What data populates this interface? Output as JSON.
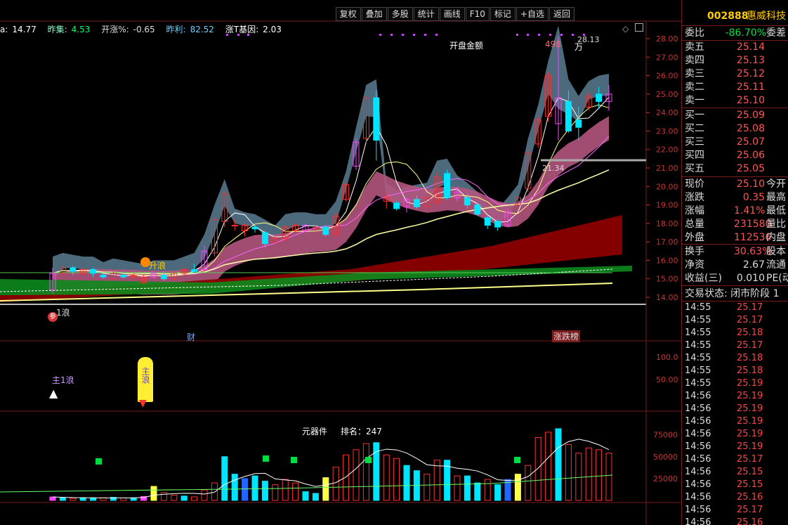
{
  "toolbar": [
    "复权",
    "叠加",
    "多股",
    "统计",
    "画线",
    "F10",
    "标记",
    "+自选",
    "返回"
  ],
  "indicator_line": {
    "a_label": "a:",
    "a_value": "14.77",
    "zj_label": "昨集:",
    "zj_value": "4.53",
    "kzf_label": "开涨%:",
    "kzf_value": "-0.65",
    "zl_label": "昨利:",
    "zl_value": "82.52",
    "ztjy_label": "涨T基因:",
    "ztjy_value": "2.03"
  },
  "main_axis": [
    "28.00",
    "27.00",
    "26.00",
    "25.00",
    "24.00",
    "23.00",
    "22.00",
    "21.00",
    "20.00",
    "19.00",
    "18.00",
    "17.00",
    "16.00",
    "15.00",
    "14.00"
  ],
  "mid_axis": [
    "100.0",
    "50.00"
  ],
  "vol_axis": [
    "75000",
    "50000",
    "25000"
  ],
  "annotations": {
    "kaipan": "开盘金额",
    "val498": "498",
    "wan": "万",
    "high": "28.13",
    "cross_time": "21.34",
    "shengliang": "升浪",
    "yilang": "1浪",
    "cai": "财",
    "zhangdiebang": "涨跌榜",
    "zhuyilang": "主1浪",
    "zhulang": "主浪",
    "yuanqijian": "元器件",
    "paiming": "排名：247",
    "canshu": "参"
  },
  "stock": {
    "code": "002888",
    "name": "惠威科技"
  },
  "weibi": {
    "label": "委比",
    "value": "-86.70%",
    "extra": "委差"
  },
  "sells": [
    {
      "label": "卖五",
      "value": "25.14"
    },
    {
      "label": "卖四",
      "value": "25.13"
    },
    {
      "label": "卖三",
      "value": "25.12"
    },
    {
      "label": "卖二",
      "value": "25.11"
    },
    {
      "label": "卖一",
      "value": "25.10"
    }
  ],
  "buys": [
    {
      "label": "买一",
      "value": "25.09"
    },
    {
      "label": "买二",
      "value": "25.08"
    },
    {
      "label": "买三",
      "value": "25.07"
    },
    {
      "label": "买四",
      "value": "25.06"
    },
    {
      "label": "买五",
      "value": "25.05"
    }
  ],
  "quote": [
    {
      "label": "现价",
      "value": "25.10",
      "extra": "今开"
    },
    {
      "label": "涨跌",
      "value": "0.35",
      "extra": "最高"
    },
    {
      "label": "涨幅",
      "value": "1.41%",
      "extra": "最低"
    },
    {
      "label": "总量",
      "value": "231580",
      "extra": "量比"
    },
    {
      "label": "外盘",
      "value": "112536",
      "extra": "内盘"
    }
  ],
  "quote2": [
    {
      "label": "换手",
      "value": "30.63%",
      "extra": "股本"
    },
    {
      "label": "净资",
      "value": "2.67",
      "extra": "流通"
    },
    {
      "label": "收益(三)",
      "value": "0.010",
      "extra": "PE(动"
    }
  ],
  "trade_status": "交易状态: 闭市阶段 1",
  "ticks": [
    {
      "t": "14:55",
      "p": "25.17"
    },
    {
      "t": "14:55",
      "p": "25.17"
    },
    {
      "t": "14:55",
      "p": "25.18"
    },
    {
      "t": "14:55",
      "p": "25.17"
    },
    {
      "t": "14:55",
      "p": "25.18"
    },
    {
      "t": "14:55",
      "p": "25.18"
    },
    {
      "t": "14:55",
      "p": "25.19"
    },
    {
      "t": "14:56",
      "p": "25.19"
    },
    {
      "t": "14:56",
      "p": "25.19"
    },
    {
      "t": "14:56",
      "p": "25.19"
    },
    {
      "t": "14:56",
      "p": "25.19"
    },
    {
      "t": "14:56",
      "p": "25.19"
    },
    {
      "t": "14:56",
      "p": "25.17"
    },
    {
      "t": "14:56",
      "p": "25.15"
    },
    {
      "t": "14:56",
      "p": "25.15"
    },
    {
      "t": "14:56",
      "p": "25.16"
    },
    {
      "t": "14:56",
      "p": "25.17"
    },
    {
      "t": "14:56",
      "p": "25.16"
    }
  ],
  "candles": [
    {
      "o": 14.4,
      "c": 15.3,
      "h": 15.6,
      "l": 14.2
    },
    {
      "o": 15.3,
      "c": 15.6,
      "h": 15.8,
      "l": 15.1
    },
    {
      "o": 15.6,
      "c": 15.4,
      "h": 15.7,
      "l": 15.2
    },
    {
      "o": 15.3,
      "c": 15.5,
      "h": 15.6,
      "l": 15.2
    },
    {
      "o": 15.5,
      "c": 15.3,
      "h": 15.6,
      "l": 15.1
    },
    {
      "o": 15.2,
      "c": 15.1,
      "h": 15.3,
      "l": 15.0
    },
    {
      "o": 15.0,
      "c": 15.3,
      "h": 15.5,
      "l": 14.9
    },
    {
      "o": 15.2,
      "c": 15.1,
      "h": 15.4,
      "l": 15.0
    },
    {
      "o": 15.1,
      "c": 15.2,
      "h": 15.3,
      "l": 14.9
    },
    {
      "o": 14.8,
      "c": 15.1,
      "h": 15.2,
      "l": 14.7
    },
    {
      "o": 15.1,
      "c": 15.3,
      "h": 15.4,
      "l": 15.0
    },
    {
      "o": 15.2,
      "c": 15.0,
      "h": 15.4,
      "l": 14.9
    },
    {
      "o": 15.0,
      "c": 15.3,
      "h": 15.4,
      "l": 14.9
    },
    {
      "o": 15.3,
      "c": 15.5,
      "h": 15.6,
      "l": 15.2
    },
    {
      "o": 15.5,
      "c": 15.4,
      "h": 15.8,
      "l": 15.3
    },
    {
      "o": 15.5,
      "c": 16.5,
      "h": 16.8,
      "l": 15.4
    },
    {
      "o": 16.4,
      "c": 18.2,
      "h": 18.4,
      "l": 16.2
    },
    {
      "o": 18.1,
      "c": 19.6,
      "h": 19.8,
      "l": 17.8
    },
    {
      "o": 17.9,
      "c": 17.9,
      "h": 18.2,
      "l": 17.6
    },
    {
      "o": 17.6,
      "c": 17.9,
      "h": 18.0,
      "l": 17.3
    },
    {
      "o": 17.8,
      "c": 17.7,
      "h": 17.9,
      "l": 17.5
    },
    {
      "o": 17.5,
      "c": 16.9,
      "h": 17.6,
      "l": 16.7
    },
    {
      "o": 17.0,
      "c": 17.2,
      "h": 17.3,
      "l": 16.8
    },
    {
      "o": 17.2,
      "c": 17.8,
      "h": 17.9,
      "l": 17.0
    },
    {
      "o": 17.6,
      "c": 17.9,
      "h": 18.0,
      "l": 17.5
    },
    {
      "o": 17.6,
      "c": 17.9,
      "h": 18.0,
      "l": 17.5
    },
    {
      "o": 17.7,
      "c": 17.8,
      "h": 17.9,
      "l": 17.6
    },
    {
      "o": 17.8,
      "c": 17.4,
      "h": 17.9,
      "l": 17.3
    },
    {
      "o": 17.4,
      "c": 18.4,
      "h": 18.6,
      "l": 17.3
    },
    {
      "o": 19.3,
      "c": 20.1,
      "h": 20.2,
      "l": 19.2
    },
    {
      "o": 21.1,
      "c": 22.4,
      "h": 22.6,
      "l": 20.9
    },
    {
      "o": 22.6,
      "c": 24.8,
      "h": 24.9,
      "l": 22.3
    },
    {
      "o": 24.8,
      "c": 22.5,
      "h": 25.2,
      "l": 21.4
    },
    {
      "o": 19.2,
      "c": 19.4,
      "h": 19.6,
      "l": 18.8
    },
    {
      "o": 19.1,
      "c": 18.8,
      "h": 19.2,
      "l": 18.7
    },
    {
      "o": 18.9,
      "c": 19.3,
      "h": 19.4,
      "l": 18.6
    },
    {
      "o": 19.3,
      "c": 18.9,
      "h": 19.5,
      "l": 18.8
    },
    {
      "o": 18.9,
      "c": 19.4,
      "h": 19.6,
      "l": 18.7
    },
    {
      "o": 19.1,
      "c": 20.5,
      "h": 20.8,
      "l": 19.0
    },
    {
      "o": 20.7,
      "c": 19.4,
      "h": 20.9,
      "l": 19.3
    },
    {
      "o": 19.4,
      "c": 19.7,
      "h": 20.0,
      "l": 19.2
    },
    {
      "o": 19.4,
      "c": 19.0,
      "h": 19.6,
      "l": 18.8
    },
    {
      "o": 19.0,
      "c": 18.5,
      "h": 19.1,
      "l": 18.4
    },
    {
      "o": 18.3,
      "c": 17.9,
      "h": 18.4,
      "l": 17.7
    },
    {
      "o": 18.1,
      "c": 17.8,
      "h": 18.2,
      "l": 17.6
    },
    {
      "o": 17.9,
      "c": 18.6,
      "h": 18.8,
      "l": 17.8
    },
    {
      "o": 19.0,
      "c": 19.4,
      "h": 19.5,
      "l": 18.9
    },
    {
      "o": 19.9,
      "c": 21.8,
      "h": 22.0,
      "l": 19.7
    },
    {
      "o": 22.3,
      "c": 23.6,
      "h": 23.8,
      "l": 22.1
    },
    {
      "o": 23.8,
      "c": 26.0,
      "h": 26.2,
      "l": 23.5
    },
    {
      "o": 23.4,
      "c": 24.8,
      "h": 28.1,
      "l": 22.5
    },
    {
      "o": 24.6,
      "c": 23.0,
      "h": 25.2,
      "l": 22.9
    },
    {
      "o": 23.6,
      "c": 23.2,
      "h": 24.3,
      "l": 22.5
    },
    {
      "o": 24.3,
      "c": 24.9,
      "h": 25.1,
      "l": 24.1
    },
    {
      "o": 25.0,
      "c": 24.6,
      "h": 25.4,
      "l": 24.2
    },
    {
      "o": 24.6,
      "c": 25.0,
      "h": 25.5,
      "l": 24.1
    }
  ],
  "volumes": [
    {
      "v": 4000,
      "c": "#ff44ff"
    },
    {
      "v": 3000,
      "c": "#00e5ff"
    },
    {
      "v": 2500,
      "c": "#ff3030"
    },
    {
      "v": 3000,
      "c": "#00e5ff"
    },
    {
      "v": 2500,
      "c": "#00e5ff"
    },
    {
      "v": 3000,
      "c": "#ff3030"
    },
    {
      "v": 3500,
      "c": "#00e5ff"
    },
    {
      "v": 2800,
      "c": "#ff3030"
    },
    {
      "v": 3000,
      "c": "#00e5ff"
    },
    {
      "v": 4500,
      "c": "#ff44ff"
    },
    {
      "v": 16000,
      "c": "#ffff44"
    },
    {
      "v": 9000,
      "c": "#ff3030"
    },
    {
      "v": 6000,
      "c": "#ff3030"
    },
    {
      "v": 5000,
      "c": "#00e5ff"
    },
    {
      "v": 4000,
      "c": "#ff3030"
    },
    {
      "v": 12000,
      "c": "#ff3030"
    },
    {
      "v": 20000,
      "c": "#ff3030"
    },
    {
      "v": 50000,
      "c": "#00e5ff"
    },
    {
      "v": 30000,
      "c": "#00e5ff"
    },
    {
      "v": 25000,
      "c": "#2266ff"
    },
    {
      "v": 28000,
      "c": "#00e5ff"
    },
    {
      "v": 22000,
      "c": "#00e5ff"
    },
    {
      "v": 18000,
      "c": "#ff3030"
    },
    {
      "v": 24000,
      "c": "#ff3030"
    },
    {
      "v": 20000,
      "c": "#ff3030"
    },
    {
      "v": 10000,
      "c": "#00e5ff"
    },
    {
      "v": 8000,
      "c": "#00e5ff"
    },
    {
      "v": 26000,
      "c": "#ffff44"
    },
    {
      "v": 38000,
      "c": "#ff3030"
    },
    {
      "v": 52000,
      "c": "#ff3030"
    },
    {
      "v": 58000,
      "c": "#ff3030"
    },
    {
      "v": 65000,
      "c": "#ff3030"
    },
    {
      "v": 66000,
      "c": "#00e5ff"
    },
    {
      "v": 52000,
      "c": "#ff3030"
    },
    {
      "v": 48000,
      "c": "#ff3030"
    },
    {
      "v": 40000,
      "c": "#00e5ff"
    },
    {
      "v": 34000,
      "c": "#00e5ff"
    },
    {
      "v": 30000,
      "c": "#ff3030"
    },
    {
      "v": 46000,
      "c": "#ff3030"
    },
    {
      "v": 46000,
      "c": "#00e5ff"
    },
    {
      "v": 28000,
      "c": "#ff3030"
    },
    {
      "v": 28000,
      "c": "#00e5ff"
    },
    {
      "v": 20000,
      "c": "#00e5ff"
    },
    {
      "v": 24000,
      "c": "#ff3030"
    },
    {
      "v": 18000,
      "c": "#00e5ff"
    },
    {
      "v": 24000,
      "c": "#2266ff"
    },
    {
      "v": 30000,
      "c": "#ffff44"
    },
    {
      "v": 40000,
      "c": "#ff3030"
    },
    {
      "v": 72000,
      "c": "#ff3030"
    },
    {
      "v": 78000,
      "c": "#ff3030"
    },
    {
      "v": 82000,
      "c": "#00e5ff"
    },
    {
      "v": 64000,
      "c": "#ff3030"
    },
    {
      "v": 54000,
      "c": "#ff3030"
    },
    {
      "v": 60000,
      "c": "#ff3030"
    },
    {
      "v": 58000,
      "c": "#ff3030"
    },
    {
      "v": 54000,
      "c": "#ff3030"
    }
  ],
  "colors": {
    "up": "#ff2d2d",
    "down": "#00e5ff",
    "ma5": "#ffffff",
    "ma10": "#ffff00",
    "ma20": "#ff66ff",
    "band": "#5a7c93",
    "pinkband": "#b2557e",
    "darkred": "#8b0000",
    "green": "#0c8a1c"
  }
}
